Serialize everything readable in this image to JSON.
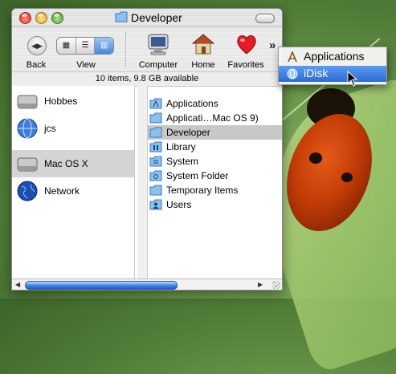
{
  "window": {
    "title": "Developer",
    "status": "10 items, 9.8 GB available"
  },
  "toolbar": {
    "back_label": "Back",
    "view_label": "View",
    "computer_label": "Computer",
    "home_label": "Home",
    "favorites_label": "Favorites",
    "overflow_glyph": "»",
    "view_modes": [
      "icon",
      "list",
      "column"
    ],
    "active_view": "column"
  },
  "sidebar": {
    "items": [
      {
        "label": "Hobbes",
        "icon": "hard-disk-icon"
      },
      {
        "label": "jcs",
        "icon": "idisk-globe-icon"
      },
      {
        "label": "Mac OS X",
        "icon": "hard-disk-icon",
        "selected": true
      },
      {
        "label": "Network",
        "icon": "network-globe-icon"
      }
    ]
  },
  "files": {
    "items": [
      {
        "label": "Applications",
        "icon": "applications-folder-icon"
      },
      {
        "label": "Applicati…Mac OS 9)",
        "icon": "folder-icon"
      },
      {
        "label": "Developer",
        "icon": "folder-icon",
        "selected": true
      },
      {
        "label": "Library",
        "icon": "library-folder-icon"
      },
      {
        "label": "System",
        "icon": "system-folder-icon"
      },
      {
        "label": "System Folder",
        "icon": "system-folder-icon"
      },
      {
        "label": "Temporary Items",
        "icon": "folder-icon"
      },
      {
        "label": "Users",
        "icon": "users-folder-icon"
      }
    ]
  },
  "menu": {
    "items": [
      {
        "label": "Applications",
        "icon": "applications-icon"
      },
      {
        "label": "iDisk",
        "icon": "idisk-icon",
        "highlighted": true
      }
    ]
  },
  "colors": {
    "selection_gray": "#d4d4d4",
    "menu_highlight": "#2f6bd3",
    "scroll_thumb": "#3a82e0"
  }
}
